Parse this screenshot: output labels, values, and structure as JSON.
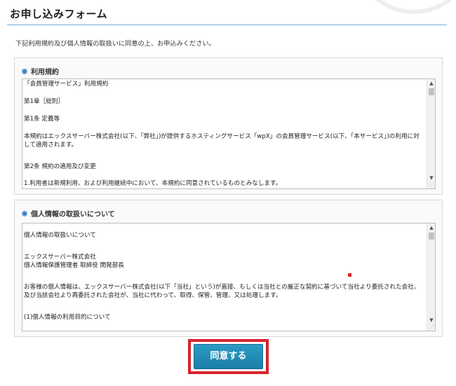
{
  "header": {
    "title": "お申し込みフォーム"
  },
  "intro": "下記利用規約及び個人情報の取扱いに同意の上、お申込みください。",
  "terms": {
    "heading": "利用規約",
    "lines": [
      "「会員管理サービス」利用規約",
      "第1章［総則］",
      "第1条 定義等",
      "本規約はエックスサーバー株式会社(以下、「弊社」)が提供するホスティングサービス「wpX」の会員管理サービス(以下、「本サービス」)の利用に対して適用されます。",
      "第2条 規約の適用及び変更",
      "1.利用者は新規利用、および利用継続中において、本規約に同意されているものとみなします。"
    ]
  },
  "privacy": {
    "heading": "個人情報の取扱いについて",
    "lines": [
      "個人情報の取扱いについて",
      "エックスサーバー株式会社",
      "個人情報保護管理者 取締役 開発部長",
      "お客様の個人情報は、エックスサーバー株式会社(以下「当社」という)が直接、もしくは当社との厳正な契約に基づいて当社より委託された会社、及び当該会社より再委託された会社が、当社に代わって、取得、保管、管理、又は処理します。",
      "(1)個人情報の利用目的について"
    ]
  },
  "agree_button": {
    "label": "同意する"
  },
  "icons": {
    "heading_bullet": "circle-bullet-icon",
    "scroll_up": "chevron-up-icon",
    "scroll_down": "chevron-down-icon",
    "resize": "resize-grip-icon"
  },
  "colors": {
    "accent_rule": "#6fb0dc",
    "bullet": "#3a7cc2",
    "button": "#2a9cc4",
    "highlight": "#d9232d"
  }
}
